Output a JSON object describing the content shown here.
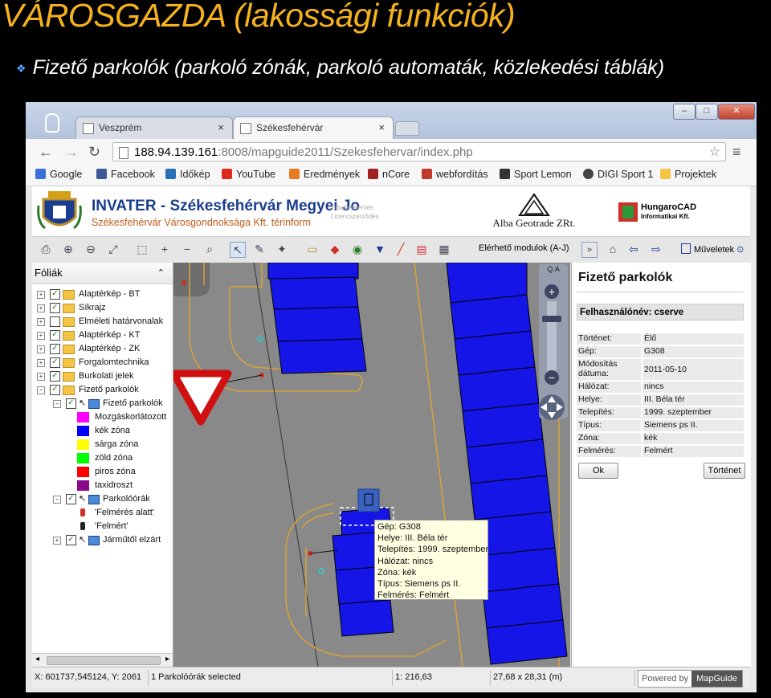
{
  "slide": {
    "title": "VÁROSGAZDA (lakossági funkciók)",
    "bullet": "Fizető parkolók (parkoló zónák, parkoló automaták, közlekedési táblák)"
  },
  "browser": {
    "tabs": [
      {
        "label": "Veszprém",
        "close": "×"
      },
      {
        "label": "Székesfehérvár",
        "close": "×"
      }
    ],
    "url_host": "188.94.139.161",
    "url_rest": ":8008/mapguide2011/Szekesfehervar/index.php",
    "bookmarks": [
      {
        "label": "Google",
        "color": "#3b6fd8"
      },
      {
        "label": "Facebook",
        "color": "#3b5998"
      },
      {
        "label": "Időkép",
        "color": "#2a6fb8"
      },
      {
        "label": "YouTube",
        "color": "#e02a20"
      },
      {
        "label": "Eredmények",
        "color": "#e87a1f"
      },
      {
        "label": "nCore",
        "color": "#a02020"
      },
      {
        "label": "webfordítás",
        "color": "#c0392b"
      },
      {
        "label": "Sport Lemon",
        "color": "#333333"
      },
      {
        "label": "DIGI Sport 1",
        "color": "#444444"
      },
      {
        "label": "Projektek",
        "color": "#f4c542"
      }
    ]
  },
  "banner": {
    "title": "INVATER - Székesfehérvár Megyei Jo",
    "subtitle": "Székesfehérvár Városgondnoksága Kft. térinform",
    "small1": "Hibabejelentés",
    "small2": "Licencszerződés",
    "alba": "Alba Geotrade ZRt.",
    "hungarocad1": "HungaroCAD",
    "hungarocad2": "Informatikai Kft."
  },
  "toolbar": {
    "modules_label": "Elérhető modulok (A-J)",
    "operations_label": "Műveletek"
  },
  "layers_panel": {
    "title": "Fóliák",
    "items": [
      {
        "label": "Alaptérkép - BT",
        "checked": true
      },
      {
        "label": "Síkrajz",
        "checked": true
      },
      {
        "label": "Elméleti határvonalak",
        "checked": false
      },
      {
        "label": "Alaptérkép - KT",
        "checked": true
      },
      {
        "label": "Alaptérkép - ZK",
        "checked": true
      },
      {
        "label": "Forgalomtechnika",
        "checked": true
      },
      {
        "label": "Burkolati jelek",
        "checked": true
      },
      {
        "label": "Fizető parkolók",
        "checked": true
      },
      {
        "label": "Fizető parkolók",
        "checked": true
      },
      {
        "label": "Mozgáskorlátozott",
        "color": "#ff00ff"
      },
      {
        "label": "kék zóna",
        "color": "#0000ff"
      },
      {
        "label": "sárga zóna",
        "color": "#ffff00"
      },
      {
        "label": "zöld zóna",
        "color": "#00ff00"
      },
      {
        "label": "piros zóna",
        "color": "#ff0000"
      },
      {
        "label": "taxidroszt",
        "color": "#8b0a8b"
      },
      {
        "label": "Parkolóórák",
        "checked": true
      },
      {
        "label": "'Felmérés alatt'"
      },
      {
        "label": "'Felmért'"
      },
      {
        "label": "Járműtől elzárt",
        "checked": true
      }
    ]
  },
  "map_tooltip": {
    "lines": [
      "Gép: G308",
      "Helye: III. Béla tér",
      "Telepítés: 1999. szeptember",
      "Hálózat: nincs",
      "Zóna: kék",
      "Típus: Siemens ps II.",
      "Felmérés: Felmért"
    ]
  },
  "properties": {
    "title": "Fizető parkolók",
    "user": "Felhasználónév: cserve",
    "rows": [
      {
        "k": "Történet:",
        "v": "Élő"
      },
      {
        "k": "Gép:",
        "v": "G308"
      },
      {
        "k": "Módosítás dátuma:",
        "v": "2011-05-10"
      },
      {
        "k": "Hálózat:",
        "v": "nincs"
      },
      {
        "k": "Helye:",
        "v": "III. Béla tér"
      },
      {
        "k": "Telepítés:",
        "v": "1999. szeptember"
      },
      {
        "k": "Típus:",
        "v": "Siemens ps II."
      },
      {
        "k": "Zóna:",
        "v": "kék"
      },
      {
        "k": "Felmérés:",
        "v": "Felmért"
      }
    ],
    "ok_label": "Ok",
    "history_label": "Történet"
  },
  "statusbar": {
    "coords": "X: 601737,545124, Y: 2061",
    "selection": "1 Parkolóórák selected",
    "scale": "1: 216,63",
    "size": "27,68 x 28,31 (m)",
    "powered": "Powered by",
    "brand": "MapGuide"
  }
}
